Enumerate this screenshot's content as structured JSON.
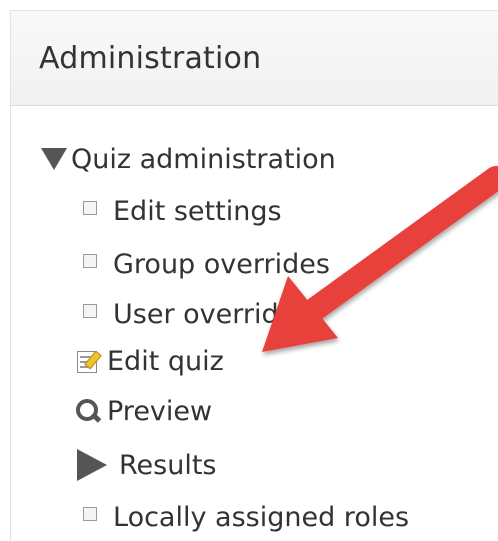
{
  "block": {
    "title": "Administration"
  },
  "tree": {
    "root_label": "Quiz administration",
    "items": [
      {
        "label": "Edit settings",
        "icon": "square-bullet-icon"
      },
      {
        "label": "Group overrides",
        "icon": "square-bullet-icon"
      },
      {
        "label": "User overrides",
        "icon": "square-bullet-icon"
      },
      {
        "label": "Edit quiz",
        "icon": "edit-icon"
      },
      {
        "label": "Preview",
        "icon": "search-icon"
      },
      {
        "label": "Results",
        "icon": "play-triangle-icon"
      },
      {
        "label": "Locally assigned roles",
        "icon": "square-bullet-icon"
      }
    ]
  },
  "annotation": {
    "arrow_color": "#e8413b"
  }
}
